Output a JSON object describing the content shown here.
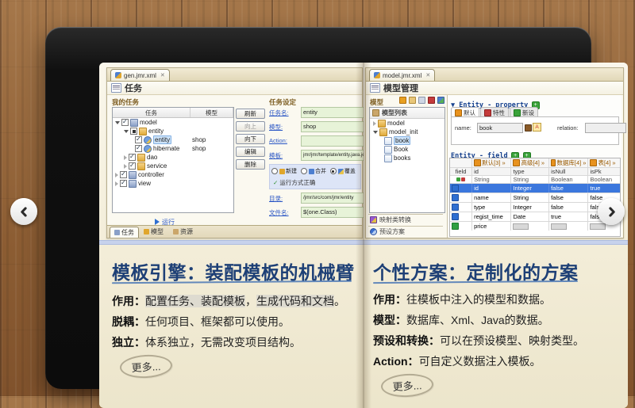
{
  "left_shot": {
    "tab_title": "gen.jmr.xml",
    "close_glyph": "✕",
    "view_title": "任务",
    "my_tasks_title": "我的任务",
    "columns": {
      "task": "任务",
      "model": "模型"
    },
    "tree": [
      {
        "label": "model"
      },
      {
        "label": "entity"
      },
      {
        "label": "entity",
        "model": "shop"
      },
      {
        "label": "hibernate",
        "model": "shop"
      },
      {
        "label": "dao"
      },
      {
        "label": "service"
      },
      {
        "label": "controller"
      },
      {
        "label": "view"
      }
    ],
    "buttons": [
      "刷新",
      "向上",
      "向下",
      "编辑",
      "删除"
    ],
    "settings_title": "任务设定",
    "form": {
      "task_name_label": "任务名:",
      "task_name": "entity",
      "model_label": "模型:",
      "model": "shop",
      "action_label": "Action:",
      "action": "",
      "template_label": "模板:",
      "template": "jmr/jmr/template/entity.java.jet",
      "dir_label": "目录:",
      "dir": "/jmr/src/com/jmr/entity",
      "file_label": "文件名:",
      "file": "$(one.Class)"
    },
    "radios": [
      "新建",
      "合并",
      "覆盖"
    ],
    "status_ok": "运行方式正确",
    "run_label": "运行",
    "bottom_tabs": [
      "任务",
      "模型",
      "资源"
    ]
  },
  "right_shot": {
    "tab_title": "model.jmr.xml",
    "close_glyph": "✕",
    "view_title": "模型管理",
    "panel_title": "模型",
    "list_title": "模型列表",
    "tree": [
      "model",
      "model_init",
      "book",
      "Book",
      "books"
    ],
    "bars": [
      "映射类转换",
      "预设方案"
    ],
    "prop_header": "Entity - property",
    "prop_tabs": [
      "默认",
      "特性",
      "新设"
    ],
    "name_label": "name:",
    "name_value": "book",
    "relation_label": "relation:",
    "relation_value": "",
    "field_header": "Entity - field",
    "table": {
      "groups": [
        "默认[3]",
        "高级[4]",
        "数据库[4]",
        "表[4]"
      ],
      "more_glyph": "»",
      "field_col": "field",
      "cols": [
        "id",
        "type",
        "isNull",
        "isPk"
      ],
      "col_types": [
        "String",
        "String",
        "Boolean",
        "Boolean"
      ],
      "rows": [
        {
          "name": "id",
          "type": "Integer",
          "isNull": "false",
          "isPk": "true"
        },
        {
          "name": "name",
          "type": "String",
          "isNull": "false",
          "isPk": "false"
        },
        {
          "name": "type",
          "type": "Integer",
          "isNull": "false",
          "isPk": "false"
        },
        {
          "name": "regist_time",
          "type": "Date",
          "isNull": "true",
          "isPk": "false"
        },
        {
          "name": "price",
          "type": "",
          "isNull": "",
          "isPk": ""
        }
      ]
    }
  },
  "left_section": {
    "heading": "模板引擎：装配模板的机械臂",
    "bullets": [
      {
        "label": "作用：",
        "hl1": "配置任务、装配模板",
        "mid": "，",
        "hl2": "生成代码和文档",
        "tail": "。"
      },
      {
        "label": "脱耦：",
        "text": "任何项目、框架都可以使用。"
      },
      {
        "label": "独立：",
        "text": "体系独立，无需改变项目结构。"
      }
    ],
    "more": "更多..."
  },
  "right_section": {
    "heading": "个性方案：定制化的方案",
    "bullets": [
      {
        "label": "作用：",
        "text": "往模板中注入的模型和数据。"
      },
      {
        "label": "模型：",
        "text": "数据库、Xml、Java的数据。"
      },
      {
        "label": "预设和转换：",
        "text": "可以在预设模型、映射类型。"
      },
      {
        "label": "Action：",
        "text": "可自定义数据注入模板。"
      }
    ],
    "more": "更多..."
  }
}
